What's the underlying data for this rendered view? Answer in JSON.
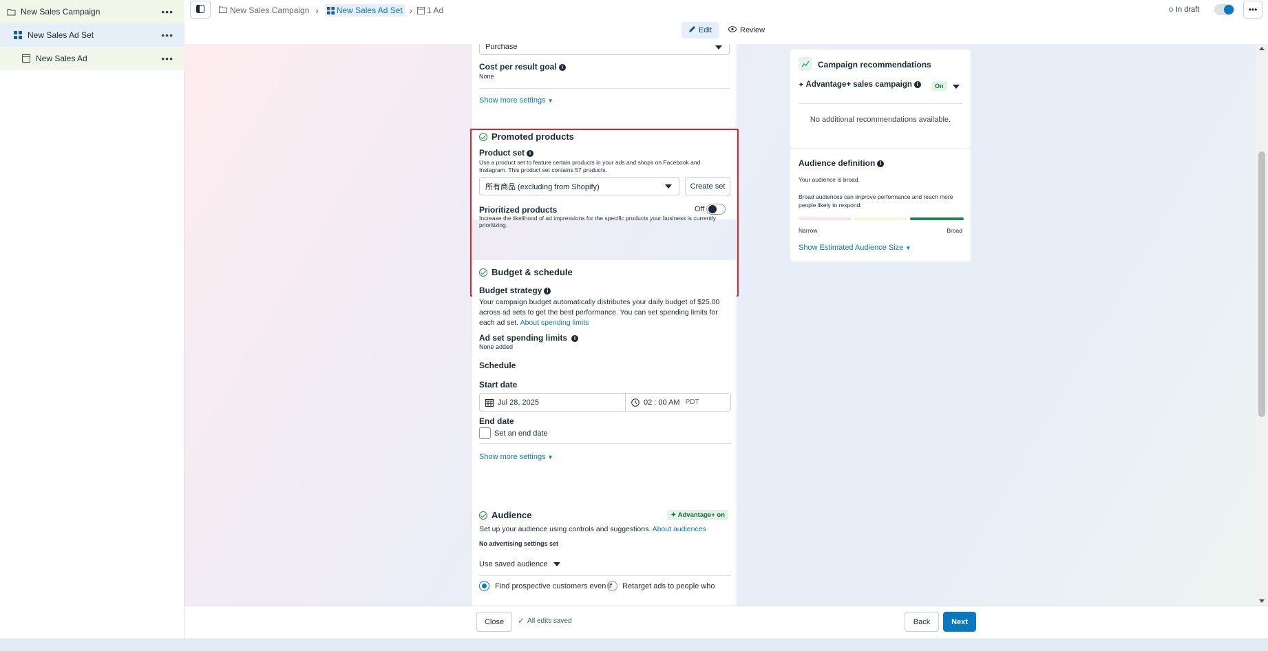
{
  "sidebar": {
    "items": [
      {
        "label": "New Sales Campaign",
        "icon": "folder-icon"
      },
      {
        "label": "New Sales Ad Set",
        "icon": "grid-icon"
      },
      {
        "label": "New Sales Ad",
        "icon": "ad-icon"
      }
    ],
    "more": "•••"
  },
  "breadcrumb": {
    "campaign": "New Sales Campaign",
    "adset": "New Sales Ad Set",
    "ad": "1 Ad"
  },
  "status": {
    "label": "In draft"
  },
  "tabs": {
    "edit": "Edit",
    "review": "Review"
  },
  "top_section": {
    "conversion_value": "Purchase",
    "cost_label": "Cost per result goal",
    "cost_value": "None",
    "show_more": "Show more settings"
  },
  "promoted": {
    "title": "Promoted products",
    "product_set_label": "Product set",
    "product_set_desc": "Use a product set to feature certain products in your ads and shops on Facebook and Instagram. This product set contains 57 products.",
    "product_set_value": "所有商品 (excluding from Shopify)",
    "create_set": "Create set",
    "prioritized_label": "Prioritized products",
    "prioritized_desc": "Increase the likelihood of ad impressions for the specific products your business is currently prioritizing.",
    "prioritized_state": "Off"
  },
  "budget": {
    "title": "Budget & schedule",
    "strategy_label": "Budget strategy",
    "strategy_text": "Your campaign budget automatically distributes your daily budget of $25.00 across ad sets to get the best performance. You can set spending limits for each ad set.",
    "strategy_link": "About spending limits",
    "limits_label": "Ad set spending limits",
    "limits_value": "None added",
    "schedule_label": "Schedule",
    "start_label": "Start date",
    "start_date": "Jul 28, 2025",
    "start_time": "02 : 00 AM",
    "timezone": "PDT",
    "end_label": "End date",
    "end_checkbox": "Set an end date",
    "show_more": "Show more settings"
  },
  "audience": {
    "title": "Audience",
    "badge": "Advantage+ on",
    "desc": "Set up your audience using controls and suggestions.",
    "desc_link": "About audiences",
    "no_settings": "No advertising settings set",
    "saved": "Use saved audience",
    "radio1": "Find prospective customers even if",
    "radio2": "Retarget ads to people who"
  },
  "recommendations": {
    "title": "Campaign recommendations",
    "advantage_label": "Advantage+ sales campaign",
    "advantage_state": "On",
    "none_text": "No additional recommendations available."
  },
  "audience_def": {
    "title": "Audience definition",
    "line1": "Your audience is broad.",
    "line2": "Broad audiences can improve performance and reach more people likely to respond.",
    "narrow": "Narrow",
    "broad": "Broad",
    "show_size": "Show Estimated Audience Size",
    "level": 1.0
  },
  "footer": {
    "close": "Close",
    "saved": "All edits saved",
    "back": "Back",
    "next": "Next"
  },
  "colors": {
    "accent": "#0a78be",
    "highlight_border": "#e0242b",
    "success": "#2a8a4a"
  }
}
